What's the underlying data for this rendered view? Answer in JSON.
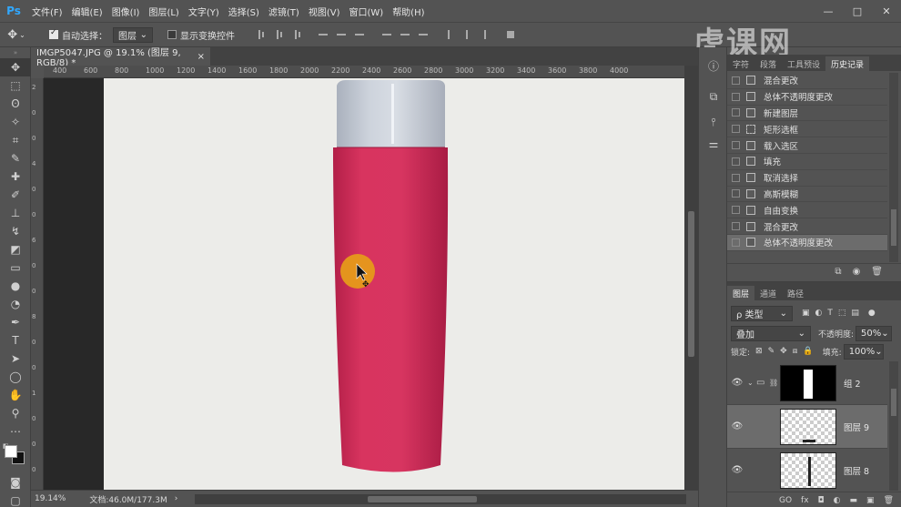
{
  "app": {
    "logo": "Ps"
  },
  "menu": [
    "文件(F)",
    "编辑(E)",
    "图像(I)",
    "图层(L)",
    "文字(Y)",
    "选择(S)",
    "滤镜(T)",
    "视图(V)",
    "窗口(W)",
    "帮助(H)"
  ],
  "window_controls": {
    "minimize": "—",
    "maximize": "□",
    "close": "✕"
  },
  "options": {
    "auto_select_label": "自动选择：",
    "auto_select_checked": true,
    "auto_select_target": "图层",
    "show_transform_label": "显示变换控件",
    "show_transform_checked": false
  },
  "watermark": "虎课网",
  "document": {
    "tab_title": "IMGP5047.JPG @ 19.1% (图层 9, RGB/8) *",
    "close": "×",
    "product_color": "#d8345f",
    "cap_color": "#c9cfd8"
  },
  "ruler_top": [
    "400",
    "600",
    "800",
    "1000",
    "1200",
    "1400",
    "1600",
    "1800",
    "2000",
    "2200",
    "2400",
    "2600",
    "2800",
    "3000",
    "3200",
    "3400",
    "3600",
    "3800",
    "4000"
  ],
  "ruler_left": [
    "2",
    "0",
    "0",
    "4",
    "0",
    "0",
    "6",
    "0",
    "0",
    "8",
    "0",
    "0",
    "1",
    "0",
    "0",
    "0"
  ],
  "status": {
    "zoom": "19.14%",
    "doc_info": "文档:46.0M/177.3M",
    "arrow": "›"
  },
  "history": {
    "tabs": [
      "字符",
      "段落",
      "工具预设",
      "历史记录"
    ],
    "active_tab": 3,
    "items": [
      "混合更改",
      "总体不透明度更改",
      "新建图层",
      "矩形选框",
      "载入选区",
      "填充",
      "取消选择",
      "高斯模糊",
      "自由变换",
      "混合更改",
      "总体不透明度更改"
    ],
    "selected_index": 10
  },
  "layers": {
    "tabs": [
      "图层",
      "通道",
      "路径"
    ],
    "active_tab": 0,
    "filter_kind": "ρ 类型",
    "blend_mode": "叠加",
    "opacity_label": "不透明度:",
    "opacity_value": "50%",
    "lock_label": "锁定:",
    "fill_label": "填充:",
    "fill_value": "100%",
    "items": [
      {
        "name": "组 2",
        "type": "group"
      },
      {
        "name": "图层 9",
        "type": "layer"
      },
      {
        "name": "图层 8",
        "type": "layer"
      }
    ],
    "selected_index": 1,
    "footer": [
      "GO",
      "fx",
      "◘",
      "◐",
      "▬",
      "▣",
      "🗑"
    ]
  }
}
